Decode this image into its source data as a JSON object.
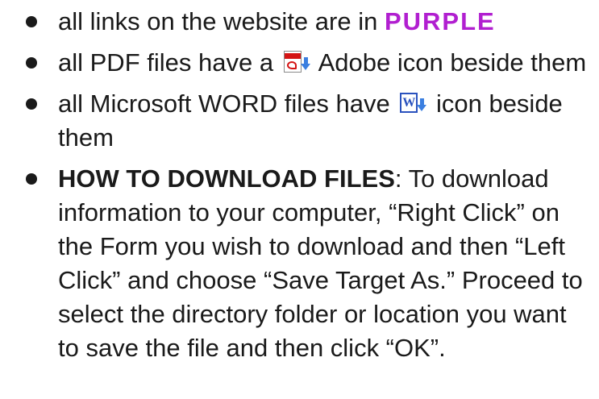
{
  "items": [
    {
      "text_before": "all links on the website are in",
      "highlight": "PURPLE",
      "highlight_color": "#b11fd0"
    },
    {
      "text_before": "all PDF files have a",
      "icon": "pdf-icon",
      "text_after": "Adobe icon beside them"
    },
    {
      "text_before": "all Microsoft WORD files have",
      "icon": "word-icon",
      "text_after": "icon beside them"
    },
    {
      "bold_lead": "HOW TO DOWNLOAD FILES",
      "text_after": ": To download information to your computer, “Right Click” on the Form you wish to download and then “Left Click” and choose “Save Target As.” Proceed to select the directory folder or location you want to save the file and then click “OK”."
    }
  ]
}
